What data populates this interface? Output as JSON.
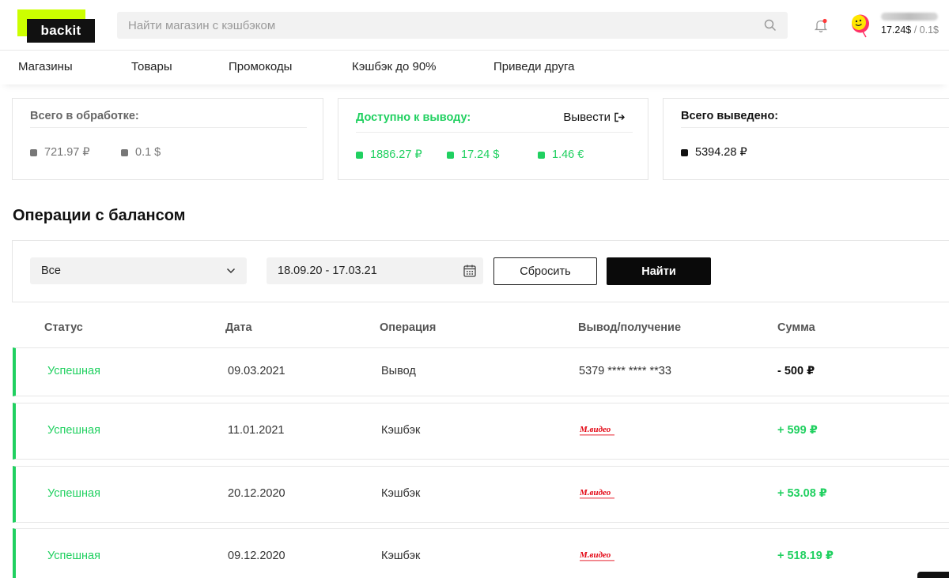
{
  "header": {
    "logo_text": "backit",
    "search_placeholder": "Найти магазин с кэшбэком",
    "balance_main": "17.24$",
    "balance_separator": " / ",
    "balance_sub": "0.1$"
  },
  "nav": {
    "items": [
      {
        "label": "Магазины"
      },
      {
        "label": "Товары"
      },
      {
        "label": "Промокоды"
      },
      {
        "label": "Кэшбэк до 90%"
      },
      {
        "label": "Приведи друга"
      }
    ]
  },
  "summary": {
    "processing": {
      "title": "Всего в обработке:",
      "values": [
        "721.97 ₽",
        "0.1 $"
      ]
    },
    "available": {
      "title": "Доступно к выводу:",
      "withdraw_label": "Вывести",
      "values": [
        "1886.27 ₽",
        "17.24 $",
        "1.46 €"
      ]
    },
    "withdrawn": {
      "title": "Всего выведено:",
      "values": [
        "5394.28 ₽"
      ]
    }
  },
  "operations": {
    "title": "Операции с балансом",
    "filter": {
      "type_value": "Все",
      "date_range": "18.09.20 - 17.03.21",
      "reset_label": "Сбросить",
      "find_label": "Найти"
    },
    "columns": [
      "Статус",
      "Дата",
      "Операция",
      "Вывод/получение",
      "Сумма"
    ],
    "rows": [
      {
        "status": "Успешная",
        "date": "09.03.2021",
        "operation": "Вывод",
        "target": "5379 **** **** **33",
        "target_type": "card",
        "amount": "- 500 ₽",
        "sign": "neg"
      },
      {
        "status": "Успешная",
        "date": "11.01.2021",
        "operation": "Кэшбэк",
        "target": "М.видео",
        "target_type": "store-logo",
        "amount": "+ 599 ₽",
        "sign": "pos"
      },
      {
        "status": "Успешная",
        "date": "20.12.2020",
        "operation": "Кэшбэк",
        "target": "М.видео",
        "target_type": "store-logo",
        "amount": "+ 53.08 ₽",
        "sign": "pos"
      },
      {
        "status": "Успешная",
        "date": "09.12.2020",
        "operation": "Кэшбэк",
        "target": "М.видео",
        "target_type": "store-logo",
        "amount": "+ 518.19 ₽",
        "sign": "pos"
      }
    ]
  },
  "colors": {
    "accent_green": "#20d060",
    "logo_lime": "#ccff00",
    "dark": "#0a0a0a",
    "mvideo_red": "#e30613"
  },
  "icons": [
    "search-icon",
    "bell-icon",
    "avatar-balloon-icon",
    "withdraw-arrow-icon",
    "chevron-down-icon",
    "calendar-icon",
    "mvideo-logo"
  ]
}
